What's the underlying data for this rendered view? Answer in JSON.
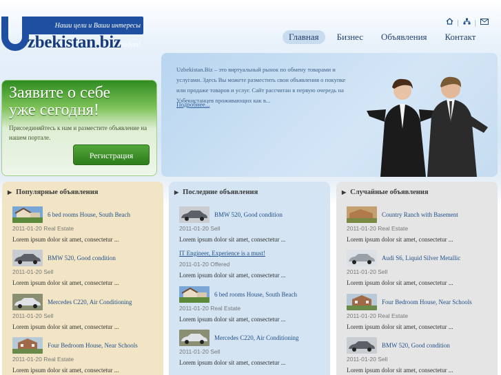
{
  "header": {
    "slogan": "Наши цели и Ваши интересы совпадут!",
    "logo_text": "zbekistan.biz",
    "icons": [
      "home-icon",
      "sitemap-icon",
      "mail-icon"
    ],
    "separator": "|"
  },
  "nav": {
    "items": [
      {
        "label": "Главная",
        "active": true
      },
      {
        "label": "Бизнес",
        "active": false
      },
      {
        "label": "Объявления",
        "active": false
      },
      {
        "label": "Контакт",
        "active": false
      }
    ]
  },
  "promo": {
    "title_line1": "Заявите о себе",
    "title_line2": "уже сегодня!",
    "subtitle": "Присоединяйтесь к нам и разместите объявление на нашем портале.",
    "button": "Регистрация"
  },
  "hero": {
    "text": "Uzbekistan.Biz – это виртуальный рынок по обмену товарами и услугами. Здесь Вы можете разместить свои объявления о покупке или продаже товаров и услуг.  Сайт рассчитан в первую очередь на Узбекистанцев проживающих как в...",
    "more": "Подробнее..."
  },
  "columns": [
    {
      "title": "Популярные объявления",
      "entries": [
        {
          "title": "6 bed rooms House, South Beach",
          "meta": "2011-01-20 Real Estate",
          "desc": "Lorem ipsum dolor sit amet, consectetur ...",
          "thumb": "house"
        },
        {
          "title": "BMW 520, Good condition",
          "meta": "2011-01-20 Sell",
          "desc": "Lorem ipsum dolor sit amet, consectetur ...",
          "thumb": "car"
        },
        {
          "title": "Mercedes C220, Air Conditioning",
          "meta": "2011-01-20 Sell",
          "desc": "Lorem ipsum dolor sit amet, consectetur ...",
          "thumb": "car"
        },
        {
          "title": "Four Bedroom House, Near Schools",
          "meta": "2011-01-20 Real Estate",
          "desc": "Lorem ipsum dolor sit amet, consectetur ...",
          "thumb": "house"
        }
      ]
    },
    {
      "title": "Последние объявления",
      "entries": [
        {
          "title": "BMW 520, Good condition",
          "meta": "2011-01-20 Sell",
          "desc": "Lorem ipsum dolor sit amet, consectetur ...",
          "thumb": "car"
        },
        {
          "title": "IT Engineer, Experience is a must!",
          "meta": "2011-01-20 Offered",
          "desc": "Lorem ipsum dolor sit amet, consectetur ...",
          "thumb": ""
        },
        {
          "title": "6 bed rooms House, South Beach",
          "meta": "2011-01-20 Real Estate",
          "desc": "Lorem ipsum dolor sit amet, consectetur ...",
          "thumb": "house"
        },
        {
          "title": "Mercedes C220, Air Conditioning",
          "meta": "2011-01-20 Sell",
          "desc": "Lorem ipsum dolor sit amet, consectetur ...",
          "thumb": "car"
        }
      ]
    },
    {
      "title": "Случайные объявления",
      "entries": [
        {
          "title": "Country Ranch with Basement",
          "meta": "2011-01-20 Real Estate",
          "desc": "Lorem ipsum dolor sit amet, consectetur ...",
          "thumb": "house"
        },
        {
          "title": "Audi S6, Liquid Silver Metallic",
          "meta": "2011-01-20 Sell",
          "desc": "Lorem ipsum dolor sit amet, consectetur ...",
          "thumb": "car"
        },
        {
          "title": "Four Bedroom House, Near Schools",
          "meta": "2011-01-20 Real Estate",
          "desc": "Lorem ipsum dolor sit amet, consectetur ...",
          "thumb": "house"
        },
        {
          "title": "BMW 520, Good condition",
          "meta": "2011-01-20 Sell",
          "desc": "Lorem ipsum dolor sit amet, consectetur ...",
          "thumb": "car"
        }
      ]
    }
  ],
  "colors": {
    "brand": "#1f4fa0",
    "green": "#2d7c1c",
    "link": "#1f4f8a"
  }
}
